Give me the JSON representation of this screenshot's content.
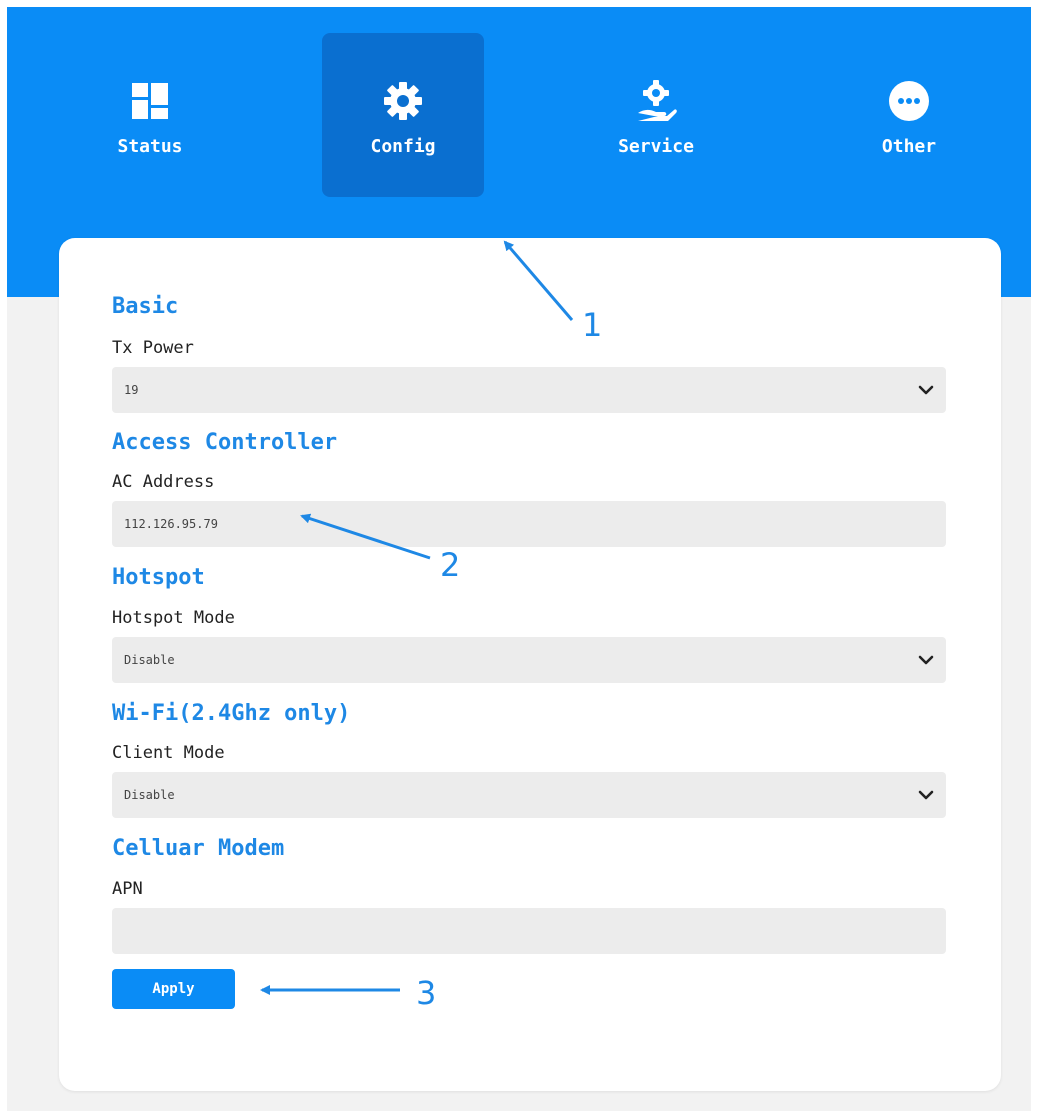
{
  "nav": {
    "items": [
      {
        "label": "Status",
        "icon": "dashboard-grid-icon",
        "active": false
      },
      {
        "label": "Config",
        "icon": "gear-icon",
        "active": true
      },
      {
        "label": "Service",
        "icon": "hand-gear-icon",
        "active": false
      },
      {
        "label": "Other",
        "icon": "more-dots-icon",
        "active": false
      }
    ]
  },
  "sections": {
    "basic": {
      "title": "Basic",
      "tx_power_label": "Tx Power",
      "tx_power_value": "19"
    },
    "access_controller": {
      "title": "Access Controller",
      "ac_address_label": "AC Address",
      "ac_address_value": "112.126.95.79"
    },
    "hotspot": {
      "title": "Hotspot",
      "hotspot_mode_label": "Hotspot Mode",
      "hotspot_mode_value": "Disable"
    },
    "wifi": {
      "title": "Wi-Fi(2.4Ghz only)",
      "client_mode_label": "Client Mode",
      "client_mode_value": "Disable"
    },
    "cellular": {
      "title": "Celluar Modem",
      "apn_label": "APN",
      "apn_value": ""
    }
  },
  "apply_label": "Apply",
  "annotations": [
    "1",
    "2",
    "3"
  ],
  "colors": {
    "header": "#0a8cf6",
    "active_tab": "#0a6fd0",
    "section_title": "#1e88e5",
    "field_bg": "#ececec",
    "button": "#0a8cf6"
  }
}
